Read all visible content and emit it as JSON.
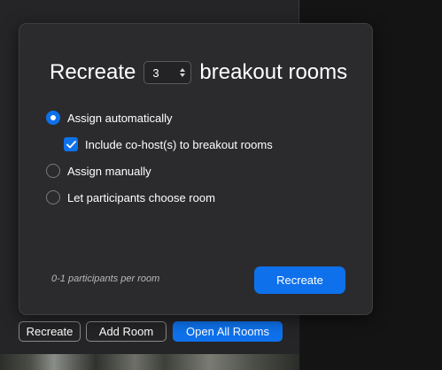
{
  "dialog": {
    "title_prefix": "Recreate",
    "room_count": "3",
    "title_suffix": "breakout rooms",
    "options": {
      "assign_automatically": "Assign automatically",
      "include_cohosts": "Include co-host(s) to breakout rooms",
      "assign_manually": "Assign manually",
      "let_participants_choose": "Let participants choose room"
    },
    "selected_option": "assign_automatically",
    "include_cohosts_checked": true,
    "participants_hint": "0-1 participants per room",
    "recreate_button": "Recreate"
  },
  "bottom_bar": {
    "recreate": "Recreate",
    "add_room": "Add Room",
    "open_all_rooms": "Open All Rooms"
  },
  "colors": {
    "accent": "#0e71eb",
    "dialog_bg": "#2b2b2d",
    "panel_bg": "#252527"
  },
  "icons": {
    "stepper": "up-down-chevron-icon",
    "checkbox": "checkmark-icon"
  }
}
